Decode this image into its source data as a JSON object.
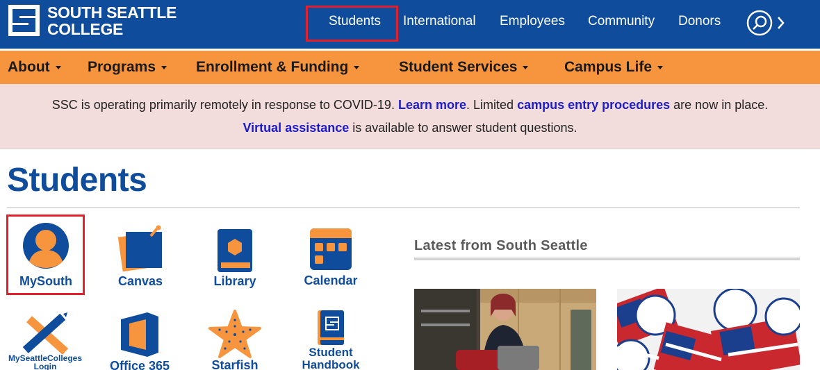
{
  "brand": {
    "line1": "SOUTH SEATTLE",
    "line2": "COLLEGE"
  },
  "topnav": {
    "items": [
      "Students",
      "International",
      "Employees",
      "Community",
      "Donors"
    ]
  },
  "mainnav": {
    "items": [
      "About",
      "Programs",
      "Enrollment & Funding",
      "Student Services",
      "Campus Life"
    ]
  },
  "alert": {
    "text1": "SSC is operating primarily remotely in response to COVID-19.",
    "link1": "Learn more",
    "text2": ". Limited",
    "link2": "campus entry procedures",
    "text3": "are now in place.",
    "link3": "Virtual assistance",
    "text4": "is available to answer student questions."
  },
  "page": {
    "title": "Students"
  },
  "tiles": {
    "mysouth": "MySouth",
    "canvas": "Canvas",
    "library": "Library",
    "calendar": "Calendar",
    "msc_line1": "MySeattleColleges",
    "msc_line2": "Login",
    "office": "Office 365",
    "starfish": "Starfish",
    "handbook_line1": "Student",
    "handbook_line2": "Handbook"
  },
  "latest": {
    "title": "Latest from South Seattle"
  },
  "colors": {
    "primary_blue": "#0f4c9c",
    "orange": "#f7953e",
    "alert_bg": "#f3dcdc",
    "link_blue": "#1d1ccc",
    "highlight_red": "#e0202a"
  }
}
